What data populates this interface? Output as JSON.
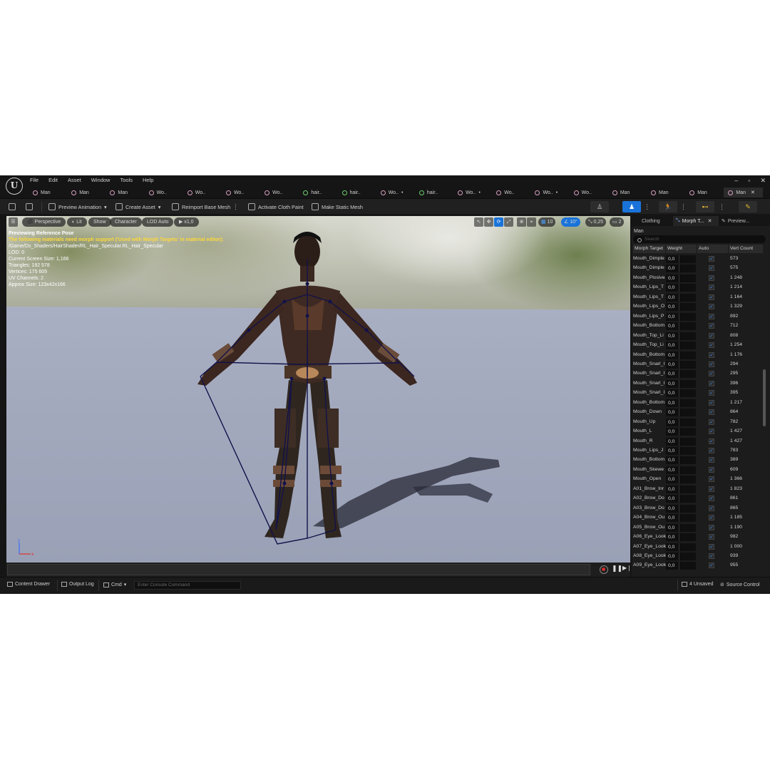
{
  "menu": [
    "File",
    "Edit",
    "Asset",
    "Window",
    "Tools",
    "Help"
  ],
  "window_controls": [
    "–",
    "▫",
    "✕"
  ],
  "tabs": [
    {
      "label": "Man",
      "icon": "skeletal-mesh-icon",
      "active": false,
      "dirty": false
    },
    {
      "label": "Man",
      "icon": "skeletal-mesh-icon",
      "active": false,
      "dirty": false
    },
    {
      "label": "Man",
      "icon": "skeletal-mesh-icon",
      "active": false,
      "dirty": false
    },
    {
      "label": "Wo..",
      "icon": "skeletal-mesh-icon",
      "active": false,
      "dirty": false
    },
    {
      "label": "Wo..",
      "icon": "skeletal-mesh-icon",
      "active": false,
      "dirty": false
    },
    {
      "label": "Wo..",
      "icon": "skeletal-mesh-icon",
      "active": false,
      "dirty": false
    },
    {
      "label": "Wo..",
      "icon": "skeletal-mesh-icon",
      "active": false,
      "dirty": false
    },
    {
      "label": "hair..",
      "icon": "material-icon",
      "active": false,
      "dirty": false
    },
    {
      "label": "hair..",
      "icon": "material-icon",
      "active": false,
      "dirty": false
    },
    {
      "label": "Wo..",
      "icon": "skeletal-mesh-icon",
      "active": false,
      "dirty": true
    },
    {
      "label": "hair..",
      "icon": "material-icon",
      "active": false,
      "dirty": false
    },
    {
      "label": "Wo..",
      "icon": "skeletal-mesh-icon",
      "active": false,
      "dirty": true
    },
    {
      "label": "Wo..",
      "icon": "skeletal-mesh-icon",
      "active": false,
      "dirty": false
    },
    {
      "label": "Wo..",
      "icon": "skeletal-mesh-icon",
      "active": false,
      "dirty": true
    },
    {
      "label": "Wo..",
      "icon": "skeletal-mesh-icon",
      "active": false,
      "dirty": false
    },
    {
      "label": "Man",
      "icon": "skeletal-mesh-icon",
      "active": false,
      "dirty": false
    },
    {
      "label": "Man",
      "icon": "skeletal-mesh-icon",
      "active": false,
      "dirty": false
    },
    {
      "label": "Man",
      "icon": "skeletal-mesh-icon",
      "active": false,
      "dirty": false
    },
    {
      "label": "Man",
      "icon": "skeletal-mesh-icon",
      "active": true,
      "dirty": false
    }
  ],
  "toolbar": {
    "preview_animation": "Preview Animation",
    "create_asset": "Create Asset",
    "reimport_base_mesh": "Reimport Base Mesh",
    "activate_cloth_paint": "Activate Cloth Paint",
    "make_static_mesh": "Make Static Mesh"
  },
  "viewport": {
    "perspective": "Perspective",
    "lit": "Lit",
    "show": "Show",
    "character": "Character",
    "lod": "LOD Auto",
    "speed": "x1,0",
    "grid_snap": "10",
    "rot_snap": "10°",
    "scale_snap": "0,25",
    "camera_speed": "2",
    "info": {
      "line1": "Previewing Reference Pose",
      "line2": "The following materials need morph support ('Used with Morph Targets' in material editor):",
      "line3": "/Game/Ds_Shaders/HairShader/RL_Hair_Specular.RL_Hair_Specular",
      "lod": "LOD: 0",
      "screen_size": "Current Screen Size: 1,166",
      "triangles": "Triangles: 192 578",
      "vertices": "Vertices: 175 605",
      "uv_channels": "UV Channels: 2",
      "approx_size": "Approx Size: 123x42x166"
    }
  },
  "statusbar": {
    "content_drawer": "Content Drawer",
    "output_log": "Output Log",
    "cmd": "Cmd",
    "console_placeholder": "Enter Console Command",
    "unsaved": "4 Unsaved",
    "source_control": "Source Control"
  },
  "right_panel": {
    "tabs": [
      "Clothing",
      "Morph T...",
      "Preview..."
    ],
    "asset_name": "Man",
    "search_placeholder": "Search",
    "columns": [
      "Morph Target",
      "Weight",
      "Auto",
      "Vert Count"
    ],
    "rows": [
      {
        "name": "Mouth_Dimple",
        "weight": "0,0",
        "auto": true,
        "vert_count": "573"
      },
      {
        "name": "Mouth_Dimple",
        "weight": "0,0",
        "auto": true,
        "vert_count": "575"
      },
      {
        "name": "Mouth_Plosive",
        "weight": "0,0",
        "auto": true,
        "vert_count": "1 248"
      },
      {
        "name": "Mouth_Lips_T",
        "weight": "0,0",
        "auto": true,
        "vert_count": "1 214"
      },
      {
        "name": "Mouth_Lips_T",
        "weight": "0,0",
        "auto": true,
        "vert_count": "1 164"
      },
      {
        "name": "Mouth_Lips_O",
        "weight": "0,0",
        "auto": true,
        "vert_count": "1 329"
      },
      {
        "name": "Mouth_Lips_P",
        "weight": "0,0",
        "auto": true,
        "vert_count": "892"
      },
      {
        "name": "Mouth_Bottom",
        "weight": "0,0",
        "auto": true,
        "vert_count": "712"
      },
      {
        "name": "Mouth_Top_Li",
        "weight": "0,0",
        "auto": true,
        "vert_count": "808"
      },
      {
        "name": "Mouth_Top_Li",
        "weight": "0,0",
        "auto": true,
        "vert_count": "1 254"
      },
      {
        "name": "Mouth_Bottom",
        "weight": "0,0",
        "auto": true,
        "vert_count": "1 176"
      },
      {
        "name": "Mouth_Snarl_I",
        "weight": "0,0",
        "auto": true,
        "vert_count": "294"
      },
      {
        "name": "Mouth_Snarl_I",
        "weight": "0,0",
        "auto": true,
        "vert_count": "295"
      },
      {
        "name": "Mouth_Snarl_I",
        "weight": "0,0",
        "auto": true,
        "vert_count": "396"
      },
      {
        "name": "Mouth_Snarl_I",
        "weight": "0,0",
        "auto": true,
        "vert_count": "395"
      },
      {
        "name": "Mouth_Bottom",
        "weight": "0,0",
        "auto": true,
        "vert_count": "1 217"
      },
      {
        "name": "Mouth_Down",
        "weight": "0,0",
        "auto": true,
        "vert_count": "864"
      },
      {
        "name": "Mouth_Up",
        "weight": "0,0",
        "auto": true,
        "vert_count": "782"
      },
      {
        "name": "Mouth_L",
        "weight": "0,0",
        "auto": true,
        "vert_count": "1 427"
      },
      {
        "name": "Mouth_R",
        "weight": "0,0",
        "auto": true,
        "vert_count": "1 427"
      },
      {
        "name": "Mouth_Lips_J",
        "weight": "0,0",
        "auto": true,
        "vert_count": "783"
      },
      {
        "name": "Mouth_Bottom",
        "weight": "0,0",
        "auto": true,
        "vert_count": "389"
      },
      {
        "name": "Mouth_Skewe",
        "weight": "0,0",
        "auto": true,
        "vert_count": "609"
      },
      {
        "name": "Mouth_Open",
        "weight": "0,0",
        "auto": true,
        "vert_count": "1 366"
      },
      {
        "name": "A01_Brow_Inr",
        "weight": "0,0",
        "auto": true,
        "vert_count": "1 823"
      },
      {
        "name": "A02_Brow_Do",
        "weight": "0,0",
        "auto": true,
        "vert_count": "861"
      },
      {
        "name": "A03_Brow_Do",
        "weight": "0,0",
        "auto": true,
        "vert_count": "865"
      },
      {
        "name": "A04_Brow_Ou",
        "weight": "0,0",
        "auto": true,
        "vert_count": "1 185"
      },
      {
        "name": "A05_Brow_Ou",
        "weight": "0,0",
        "auto": true,
        "vert_count": "1 190"
      },
      {
        "name": "A06_Eye_Look",
        "weight": "0,0",
        "auto": true,
        "vert_count": "982"
      },
      {
        "name": "A07_Eye_Look",
        "weight": "0,0",
        "auto": true,
        "vert_count": "1 000"
      },
      {
        "name": "A08_Eye_Look",
        "weight": "0,0",
        "auto": true,
        "vert_count": "939"
      },
      {
        "name": "A09_Eye_Look",
        "weight": "0,0",
        "auto": true,
        "vert_count": "955"
      }
    ]
  },
  "colors": {
    "accent": "#1a73d9",
    "warning_text": "#ffd83a",
    "checkbox": "#3d8ef0"
  }
}
